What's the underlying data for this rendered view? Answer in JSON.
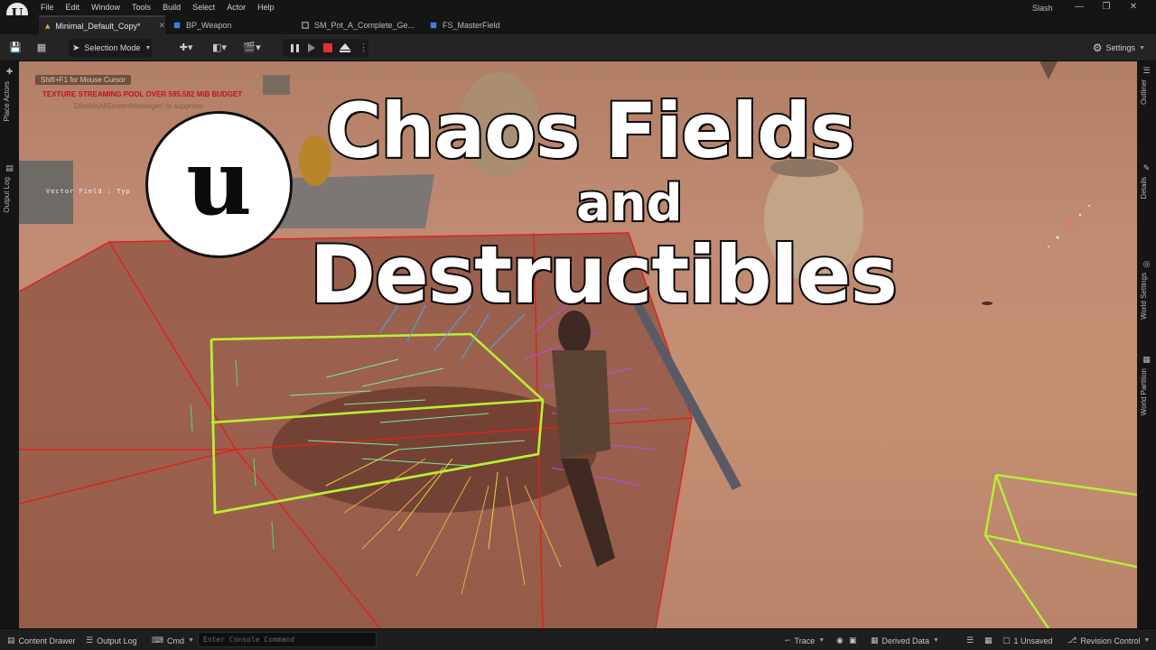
{
  "menubar": {
    "items": [
      "File",
      "Edit",
      "Window",
      "Tools",
      "Build",
      "Select",
      "Actor",
      "Help"
    ],
    "user": "Slash"
  },
  "tabs": [
    {
      "label": "Minimal_Default_Copy*",
      "active": true
    },
    {
      "label": "BP_Weapon",
      "active": false
    },
    {
      "label": "SM_Pot_A_Complete_Ge...",
      "active": false
    },
    {
      "label": "FS_MasterField",
      "active": false
    }
  ],
  "toolbar": {
    "mode_label": "Selection Mode",
    "settings_label": "Settings"
  },
  "left_panel": [
    "Place Actors",
    "Output Log"
  ],
  "right_panel": [
    "Outliner",
    "Details",
    "World Settings",
    "World Partition"
  ],
  "viewport": {
    "hint": "Shift+F1 for Mouse Cursor",
    "warning": "TEXTURE STREAMING POOL OVER 595.582 MiB BUDGET",
    "suppress": "'DisableAllScreenMessages' to suppress",
    "vector_label": "Vector Field : Typ",
    "logo_letter": "u",
    "title_line1": "Chaos Fields",
    "title_line2": "and",
    "title_line3": "Destructibles"
  },
  "statusbar": {
    "content_drawer": "Content Drawer",
    "output_log": "Output Log",
    "cmd": "Cmd",
    "console_placeholder": "Enter Console Command",
    "trace": "Trace",
    "derived_data": "Derived Data",
    "unsaved": "1 Unsaved",
    "revision_control": "Revision Control"
  },
  "colors": {
    "chrome_dark": "#151515",
    "toolbar": "#242424",
    "sand": "#c08b72",
    "box_line": "#e0201e",
    "field_box": "#b8f032",
    "warning_text": "#c4111b"
  }
}
